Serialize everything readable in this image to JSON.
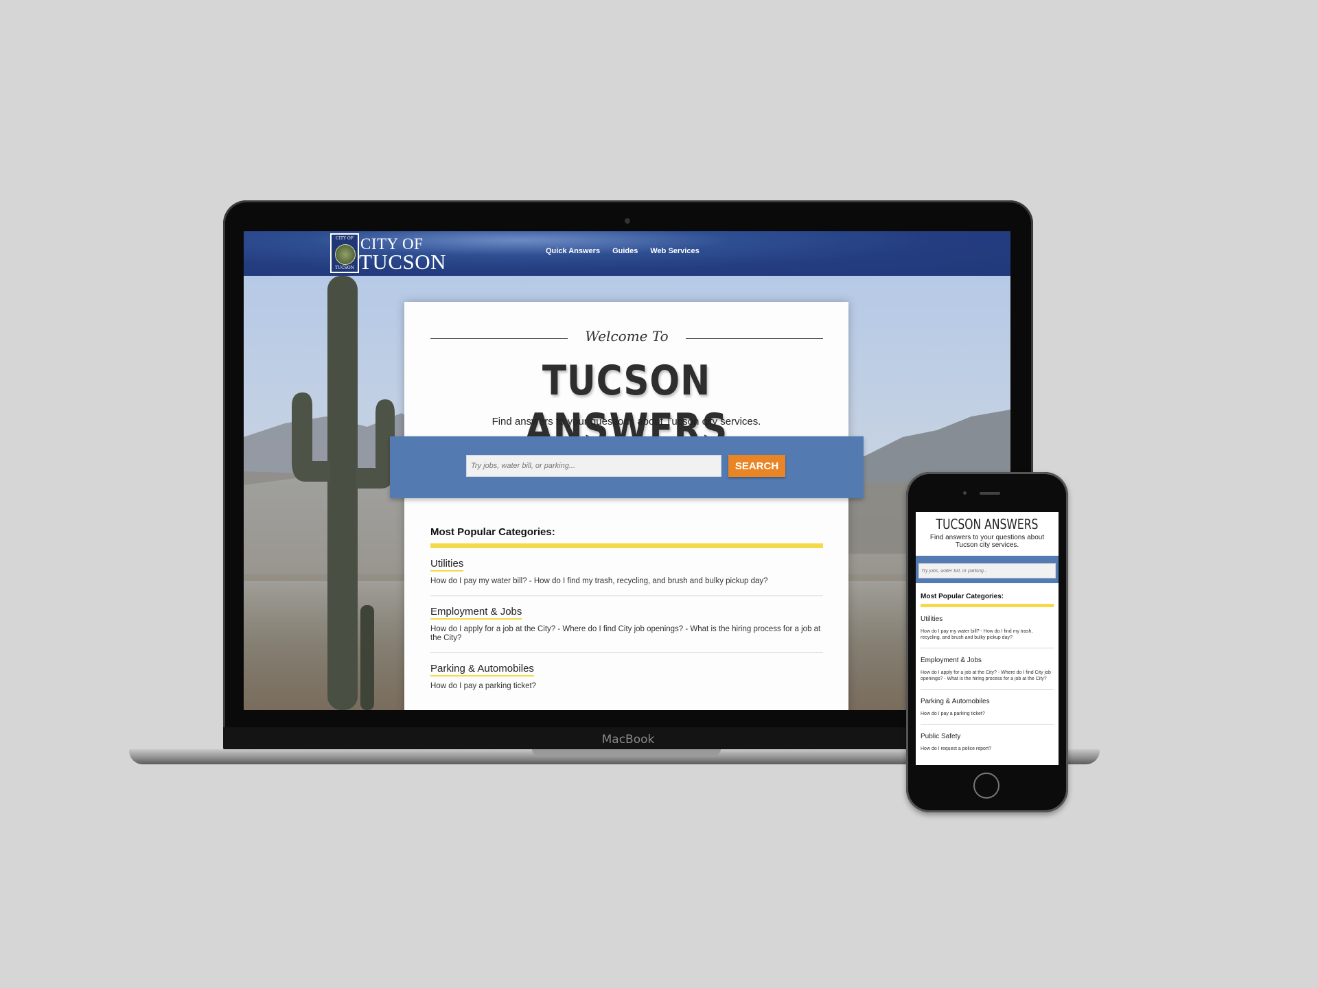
{
  "laptop": {
    "brand": "MacBook",
    "header": {
      "logo_line1": "CITY OF",
      "logo_line2": "TUCSON",
      "seal_top": "CITY OF",
      "seal_bottom": "TUCSON",
      "nav": [
        "Quick Answers",
        "Guides",
        "Web Services"
      ]
    },
    "card": {
      "welcome": "Welcome To",
      "title": "TUCSON ANSWERS",
      "subtitle": "Find answers to your questions about Tucson city services.",
      "search_placeholder": "Try jobs, water bill, or parking...",
      "search_button": "SEARCH",
      "categories_title": "Most Popular Categories:",
      "categories": [
        {
          "name": "Utilities",
          "desc": "How do I pay my water bill? - How do I find my trash, recycling, and brush and bulky pickup day?"
        },
        {
          "name": "Employment & Jobs",
          "desc": "How do I apply for a job at the City? - Where do I find City job openings? - What is the hiring process for a job at the City?"
        },
        {
          "name": "Parking & Automobiles",
          "desc": "How do I pay a parking ticket?"
        }
      ]
    }
  },
  "phone": {
    "title": "TUCSON ANSWERS",
    "subtitle": "Find answers to your questions about Tucson city services.",
    "search_placeholder": "Try jobs, water bill, or parking...",
    "categories_title": "Most Popular Categories:",
    "categories": [
      {
        "name": "Utilities",
        "desc": "How do I pay my water bill? - How do I find my trash, recycling, and brush and bulky pickup day?"
      },
      {
        "name": "Employment & Jobs",
        "desc": "How do I apply for a job at the City? - Where do I find City job openings? - What is the hiring process for a job at the City?"
      },
      {
        "name": "Parking & Automobiles",
        "desc": "How do I pay a parking ticket?"
      },
      {
        "name": "Public Safety",
        "desc": "How do I request a police report?"
      }
    ]
  },
  "colors": {
    "header_blue": "#243d80",
    "search_band": "#537bb2",
    "search_button": "#e98525",
    "accent_yellow": "#f4d94a",
    "backdrop": "#d6d6d6"
  }
}
